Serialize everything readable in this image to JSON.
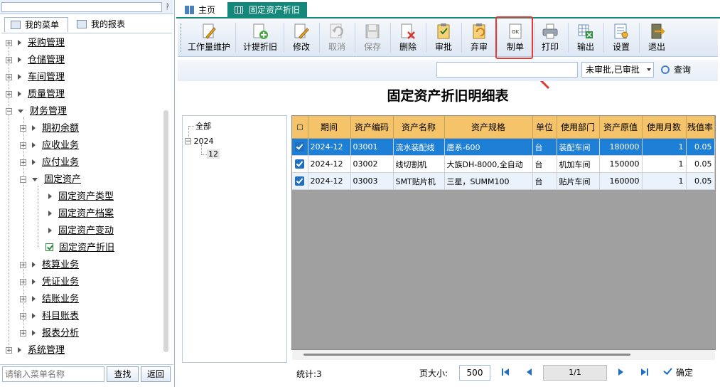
{
  "left": {
    "tabs": [
      "我的菜单",
      "我的报表"
    ],
    "pin_glyph": "ᚹ",
    "tree": [
      {
        "label": "采购管理"
      },
      {
        "label": "仓储管理"
      },
      {
        "label": "车间管理"
      },
      {
        "label": "质量管理"
      },
      {
        "label": "财务管理"
      },
      {
        "label": "期初余额"
      },
      {
        "label": "应收业务"
      },
      {
        "label": "应付业务"
      },
      {
        "label": "固定资产"
      },
      {
        "label": "固定资产类型"
      },
      {
        "label": "固定资产档案"
      },
      {
        "label": "固定资产变动"
      },
      {
        "label": "固定资产折旧"
      },
      {
        "label": "核算业务"
      },
      {
        "label": "凭证业务"
      },
      {
        "label": "结账业务"
      },
      {
        "label": "科目账表"
      },
      {
        "label": "报表分析"
      },
      {
        "label": "系统管理"
      }
    ],
    "search_placeholder": "请输入菜单名称",
    "find_label": "查找",
    "back_label": "返回"
  },
  "tabs": {
    "home": "主页",
    "active": "固定资产折旧"
  },
  "toolbar": [
    {
      "label": "工作量维护",
      "icon": "pencil-doc-icon"
    },
    {
      "label": "计提折旧",
      "icon": "add-doc-icon"
    },
    {
      "label": "修改",
      "icon": "edit-icon"
    },
    {
      "label": "取消",
      "icon": "undo-icon"
    },
    {
      "label": "保存",
      "icon": "save-icon"
    },
    {
      "label": "删除",
      "icon": "delete-doc-icon"
    },
    {
      "label": "审批",
      "icon": "clipboard-approve-icon"
    },
    {
      "label": "弃审",
      "icon": "clipboard-revoke-icon"
    },
    {
      "label": "制单",
      "icon": "ok-doc-icon",
      "icon_text": "OK"
    },
    {
      "label": "打印",
      "icon": "printer-icon"
    },
    {
      "label": "输出",
      "icon": "export-excel-icon"
    },
    {
      "label": "设置",
      "icon": "settings-icon"
    },
    {
      "label": "退出",
      "icon": "exit-icon"
    }
  ],
  "filter": {
    "search_value": "",
    "status": "未审批,已审批",
    "query_label": "查询"
  },
  "report_title": "固定资产折旧明细表",
  "period_tree": {
    "root": "全部",
    "year": "2024",
    "month": "12"
  },
  "table": {
    "columns": [
      "期间",
      "资产编码",
      "资产名称",
      "资产规格",
      "单位",
      "使用部门",
      "资产原值",
      "使用月数",
      "残值率"
    ],
    "rows": [
      [
        "2024-12",
        "03001",
        "流水装配线",
        "唐系-600",
        "台",
        "装配车间",
        "180000",
        "1",
        "0.05"
      ],
      [
        "2024-12",
        "03002",
        "线切割机",
        "大族DH-8000,全自动",
        "台",
        "机加车间",
        "150000",
        "1",
        "0.05"
      ],
      [
        "2024-12",
        "03003",
        "SMT贴片机",
        "三星，SUMM100",
        "台",
        "贴片车间",
        "160000",
        "1",
        "0.05"
      ]
    ]
  },
  "footer": {
    "stat": "统计:3",
    "page_size_label": "页大小:",
    "page_size": "500",
    "page_indicator": "1/1",
    "confirm_label": "确定"
  },
  "colors": {
    "accent": "#14897b",
    "header": "#f5c36a",
    "selected_row": "#1e7fd6",
    "highlight_box": "#e53935"
  }
}
